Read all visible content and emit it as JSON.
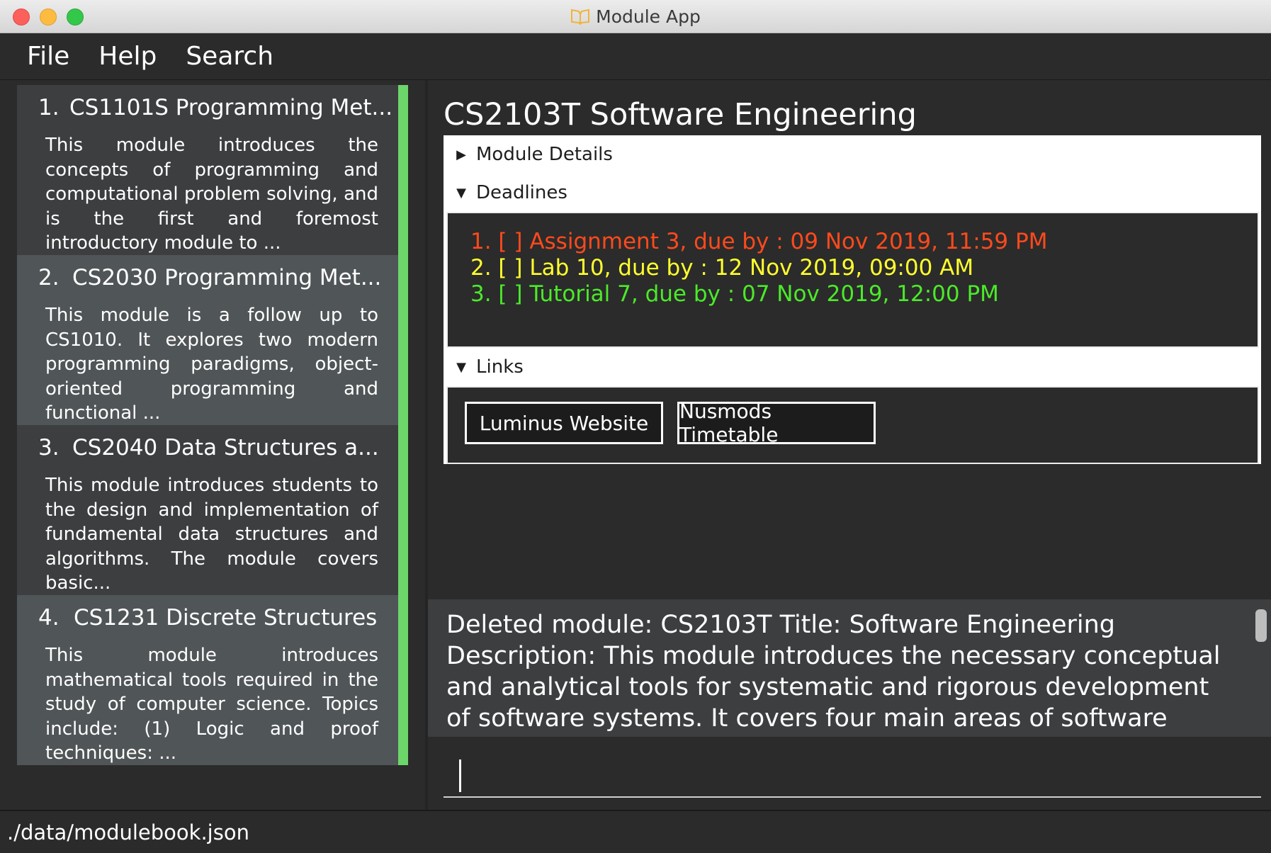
{
  "window": {
    "title": "Module App"
  },
  "menu": [
    "File",
    "Help",
    "Search"
  ],
  "modules": [
    {
      "index": "1.",
      "title": "CS1101S Programming Met...",
      "description": "This module introduces the concepts of programming and computational problem solving, and is the first and foremost introductory module to ..."
    },
    {
      "index": "2.",
      "title": "CS2030 Programming Met...",
      "description": "This module is a follow up to CS1010. It explores two modern programming paradigms, object-oriented programming and functional ..."
    },
    {
      "index": "3.",
      "title": "CS2040 Data Structures a...",
      "description": "This module introduces students to the design and implementation of fundamental data structures and algorithms. The module covers basic..."
    },
    {
      "index": "4.",
      "title": "CS1231 Discrete Structures",
      "description": "This module introduces mathematical tools required in the study of computer science. Topics include: (1) Logic and proof techniques: ..."
    }
  ],
  "detail": {
    "title": "CS2103T Software Engineering",
    "sections": {
      "module_details": "Module Details",
      "deadlines": "Deadlines",
      "links": "Links"
    },
    "deadlines": [
      {
        "text": "1. [ ] Assignment 3, due by : 09 Nov 2019, 11:59 PM",
        "color": "#ff4a1c"
      },
      {
        "text": "2. [ ] Lab 10, due by : 12 Nov 2019, 09:00 AM",
        "color": "#ffff2e"
      },
      {
        "text": "3. [ ] Tutorial 7, due by : 07 Nov 2019, 12:00 PM",
        "color": "#4bea2a"
      }
    ],
    "links": [
      "Luminus Website",
      "Nusmods Timetable"
    ]
  },
  "result": {
    "text": "Deleted module: CS2103T Title: Software Engineering Description: This module introduces the necessary conceptual and analytical tools for systematic and rigorous development of software systems. It covers four main areas of software development,"
  },
  "command": {
    "value": ""
  },
  "status": {
    "file_path": "./data/modulebook.json"
  },
  "colors": {
    "accent_bar": "#6cd66a",
    "background": "#2b2b2b",
    "card": "#3c3e3f",
    "card_alt": "#505557"
  }
}
